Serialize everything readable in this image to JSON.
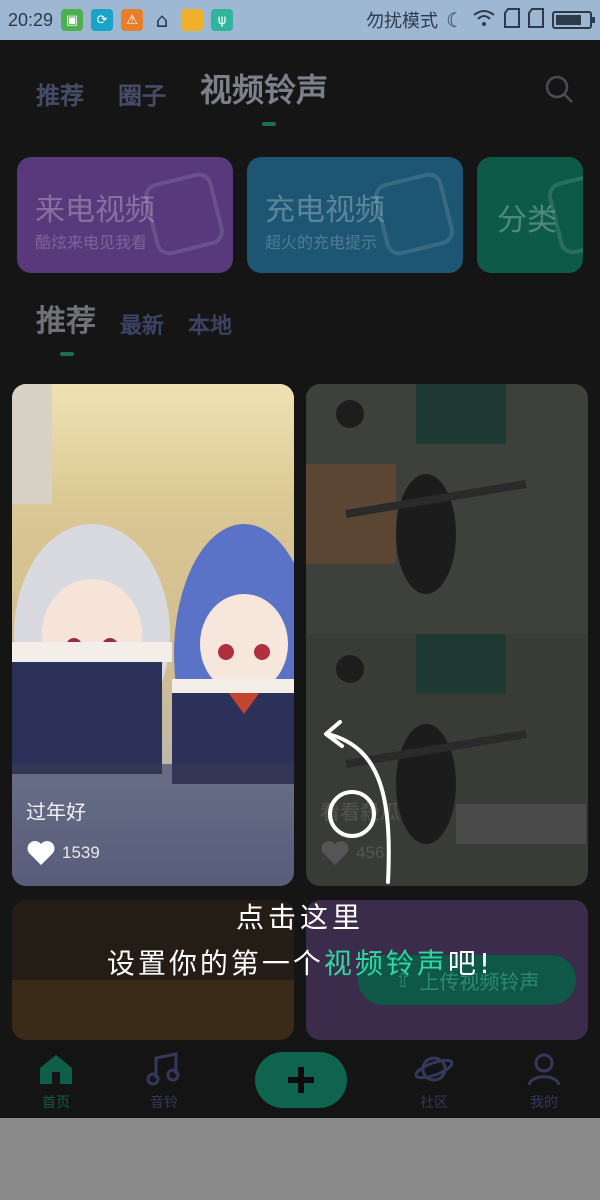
{
  "status_bar": {
    "time": "20:29",
    "dnd_label": "勿扰模式",
    "battery_percent": 70
  },
  "top_tabs": [
    {
      "label": "推荐",
      "active": false
    },
    {
      "label": "圈子",
      "active": false
    },
    {
      "label": "视频铃声",
      "active": true
    }
  ],
  "categories": [
    {
      "title": "来电视频",
      "subtitle": "酷炫来电见我看",
      "color": "#5b3d80"
    },
    {
      "title": "充电视频",
      "subtitle": "超火的充电提示",
      "color": "#1f5c79"
    },
    {
      "title": "分类",
      "subtitle": "",
      "color": "#0f5e4c"
    }
  ],
  "sub_tabs": [
    {
      "label": "推荐",
      "active": true
    },
    {
      "label": "最新",
      "active": false
    },
    {
      "label": "本地",
      "active": false
    }
  ],
  "videos": [
    {
      "title": "过年好",
      "likes": "1539"
    },
    {
      "title": "看看殺瓜",
      "likes": "456"
    }
  ],
  "upload_button": {
    "label": "上传视频铃声"
  },
  "guide": {
    "line1": "点击这里",
    "line2_prefix": "设置你的第一个",
    "line2_highlight": "视频铃声",
    "line2_suffix": "吧!"
  },
  "bottom_nav": [
    {
      "label": "首页",
      "icon": "home-icon",
      "active": true
    },
    {
      "label": "音铃",
      "icon": "music-note-icon",
      "active": false
    },
    {
      "label": "",
      "icon": "plus-icon",
      "active": false
    },
    {
      "label": "社区",
      "icon": "planet-icon",
      "active": false
    },
    {
      "label": "我的",
      "icon": "user-icon",
      "active": false
    }
  ]
}
